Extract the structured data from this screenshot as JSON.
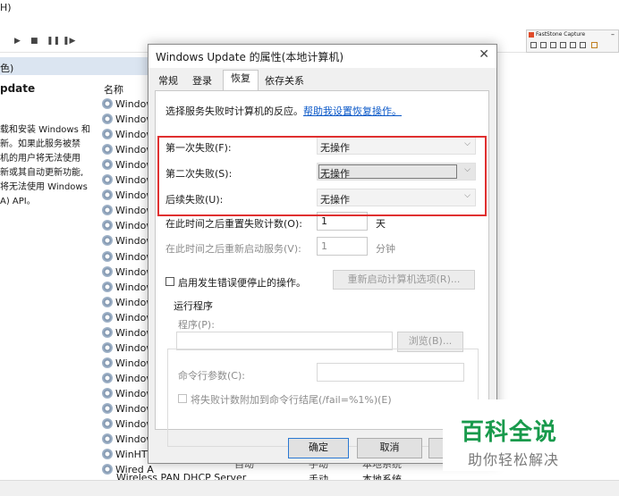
{
  "console": {
    "menu_fragment": "H)",
    "breadcrumb_fragment": "色)",
    "service_title_fragment": "pdate",
    "service_desc_lines": [
      "载和安装 Windows 和",
      "新。如果此服务被禁",
      "机的用户将无法使用",
      "新或其自动更新功能,",
      "将无法使用 Windows",
      "A) API。"
    ],
    "column_name": "名称",
    "service_rows": [
      "Window",
      "Window",
      "Window",
      "Window",
      "Window",
      "Window",
      "Window",
      "Window",
      "Window",
      "Window",
      "Window",
      "Window",
      "Window",
      "Window",
      "Window",
      "Window",
      "Window",
      "Window",
      "Window",
      "Window",
      "Window",
      "Window",
      "Window",
      "WinHTT",
      "Wired A"
    ],
    "bottom_row": {
      "name": "Wireless PAN DHCP Server",
      "startup": "手动",
      "logon": "本地系统"
    },
    "partial_row": {
      "desc": "自动",
      "startup": "手动",
      "logon": "本地系统"
    }
  },
  "faststone": {
    "title": "FastStone Capture",
    "minimize": "–"
  },
  "dialog": {
    "title": "Windows Update 的属性(本地计算机)",
    "close_glyph": "✕",
    "tabs": [
      "常规",
      "登录",
      "恢复",
      "依存关系"
    ],
    "active_tab": 2,
    "intro_text": "选择服务失败时计算机的反应。",
    "intro_link": "帮助我设置恢复操作。",
    "first_failure": {
      "label": "第一次失败(F):",
      "value": "无操作"
    },
    "second_failure": {
      "label": "第二次失败(S):",
      "value": "无操作"
    },
    "subsequent_failure": {
      "label": "后续失败(U):",
      "value": "无操作"
    },
    "reset_count": {
      "label": "在此时间之后重置失败计数(O):",
      "value": "1",
      "unit": "天"
    },
    "restart_service": {
      "label": "在此时间之后重新启动服务(V):",
      "value": "1",
      "unit": "分钟"
    },
    "enable_stop_actions": {
      "label": "启用发生错误便停止的操作。"
    },
    "restart_options_button": "重新启动计算机选项(R)...",
    "run_program": {
      "group_label": "运行程序",
      "program_label": "程序(P):",
      "browse_button": "浏览(B)...",
      "params_label": "命令行参数(C):",
      "append_label": "将失败计数附加到命令行结尾(/fail=%1%)(E)"
    },
    "ok_button": "确定",
    "cancel_button": "取消"
  },
  "watermark": {
    "main": "百科全说",
    "sub": "助你轻松解决"
  },
  "colors": {
    "highlight_border": "#e03030",
    "link": "#0b58c8",
    "watermark_green": "#199a4c"
  }
}
